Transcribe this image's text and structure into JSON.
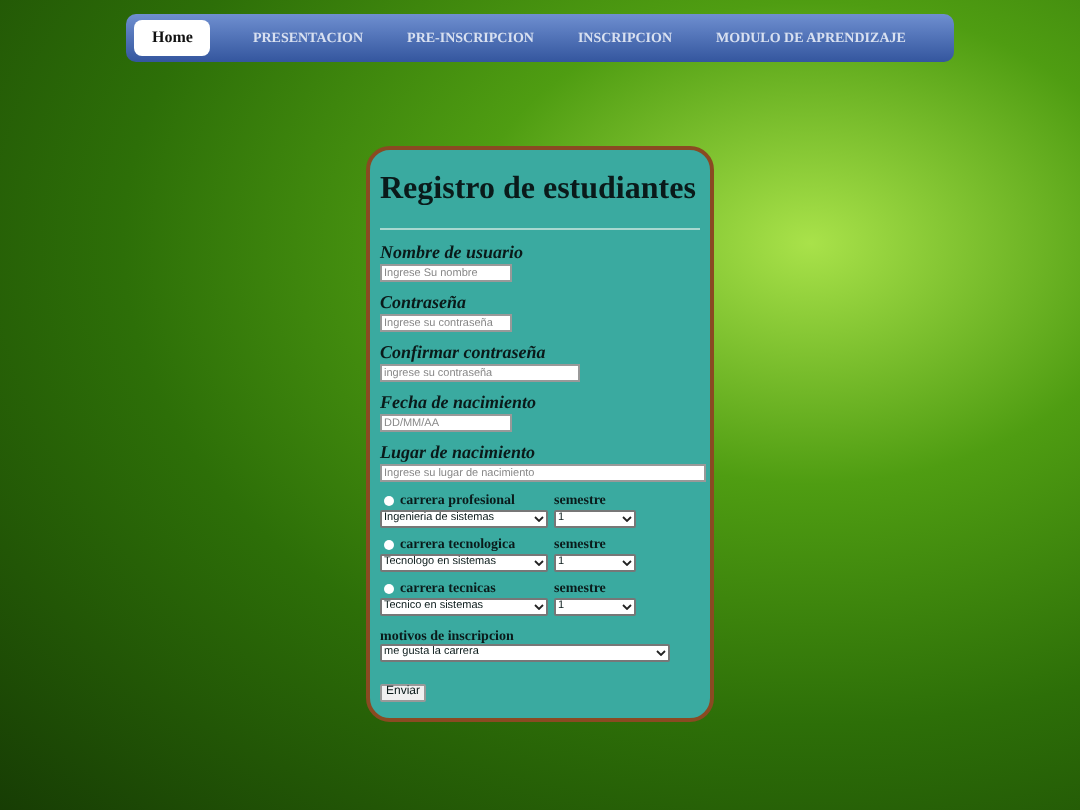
{
  "nav": [
    {
      "label": "Home",
      "selected": true
    },
    {
      "label": "PRESENTACION",
      "selected": false
    },
    {
      "label": "PRE-INSCRIPCION",
      "selected": false
    },
    {
      "label": "INSCRIPCION",
      "selected": false
    },
    {
      "label": "MODULO DE APRENDIZAJE",
      "selected": false
    }
  ],
  "form": {
    "title": "Registro de estudiantes",
    "fields": [
      {
        "label": "Nombre de usuario",
        "placeholder": "Ingrese Su nombre",
        "kind": "short"
      },
      {
        "label": "Contraseña",
        "placeholder": "Ingrese su contraseña",
        "kind": "short"
      },
      {
        "label": "Confirmar contraseña",
        "placeholder": "ingrese su contraseña",
        "kind": "medium"
      },
      {
        "label": "Fecha de nacimiento",
        "placeholder": "DD/MM/AA",
        "kind": "short"
      },
      {
        "label": "Lugar de nacimiento",
        "placeholder": "Ingrese su lugar de nacimiento",
        "kind": "long"
      }
    ],
    "careers": [
      {
        "label": "carrera profesional",
        "selected": false,
        "program": "Ingenieria de sistemas",
        "semester_label": "semestre",
        "semester": "1"
      },
      {
        "label": "carrera tecnologica",
        "selected": false,
        "program": "Tecnologo en sistemas",
        "semester_label": "semestre",
        "semester": "1"
      },
      {
        "label": "carrera tecnicas",
        "selected": false,
        "program": "Tecnico en sistemas",
        "semester_label": "semestre",
        "semester": "1"
      }
    ],
    "reasons_label": "motivos de inscripcion",
    "reason": "me gusta la carrera",
    "submit": "Enviar"
  }
}
